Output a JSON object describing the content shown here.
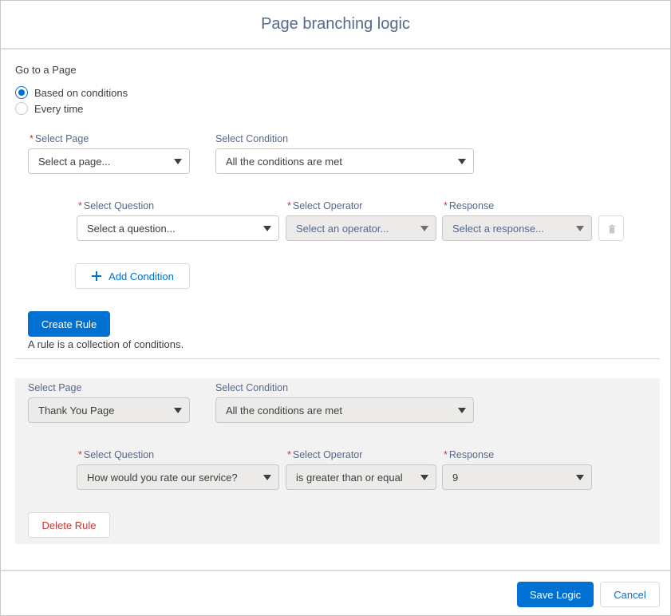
{
  "modal": {
    "title": "Page branching logic"
  },
  "go_to": {
    "heading": "Go to a Page",
    "options": [
      {
        "label": "Based on conditions",
        "checked": true
      },
      {
        "label": "Every time",
        "checked": false
      }
    ]
  },
  "new_rule": {
    "page_label": "Select Page",
    "page_placeholder": "Select a page...",
    "condition_label": "Select Condition",
    "condition_value": "All the conditions are met",
    "question_label": "Select Question",
    "question_placeholder": "Select a question...",
    "operator_label": "Select Operator",
    "operator_placeholder": "Select an operator...",
    "response_label": "Response",
    "response_placeholder": "Select a response...",
    "add_condition": "Add Condition",
    "create_rule": "Create Rule",
    "help_text": "A rule is a collection of conditions."
  },
  "existing_rule": {
    "page_label": "Select Page",
    "page_value": "Thank You Page",
    "condition_label": "Select Condition",
    "condition_value": "All the conditions are met",
    "question_label": "Select Question",
    "question_value": "How would you rate our service?",
    "operator_label": "Select Operator",
    "operator_value": "is greater than or equal",
    "response_label": "Response",
    "response_value": "9",
    "delete_rule": "Delete Rule"
  },
  "footer": {
    "save": "Save Logic",
    "cancel": "Cancel"
  },
  "required_marker": "*"
}
